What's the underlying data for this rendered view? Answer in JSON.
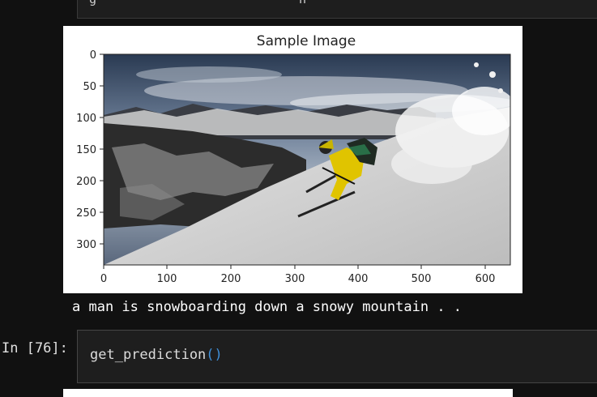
{
  "previous_cell": {
    "fragment_start": "g",
    "fragment_end": "n",
    "fragment_mid": "_"
  },
  "figure": {
    "title": "Sample Image",
    "x_ticks": [
      "0",
      "100",
      "200",
      "300",
      "400",
      "500",
      "600"
    ],
    "y_ticks": [
      "0",
      "50",
      "100",
      "150",
      "200",
      "250",
      "300"
    ]
  },
  "caption": "a man is snowboarding down a snowy mountain . .",
  "cell": {
    "prompt": "In [76]:",
    "code_fn": "get_prediction",
    "code_parens": "()"
  },
  "colors": {
    "background": "#111111",
    "cell_background": "#1e1e1e",
    "paren": "#3f8fd8"
  }
}
